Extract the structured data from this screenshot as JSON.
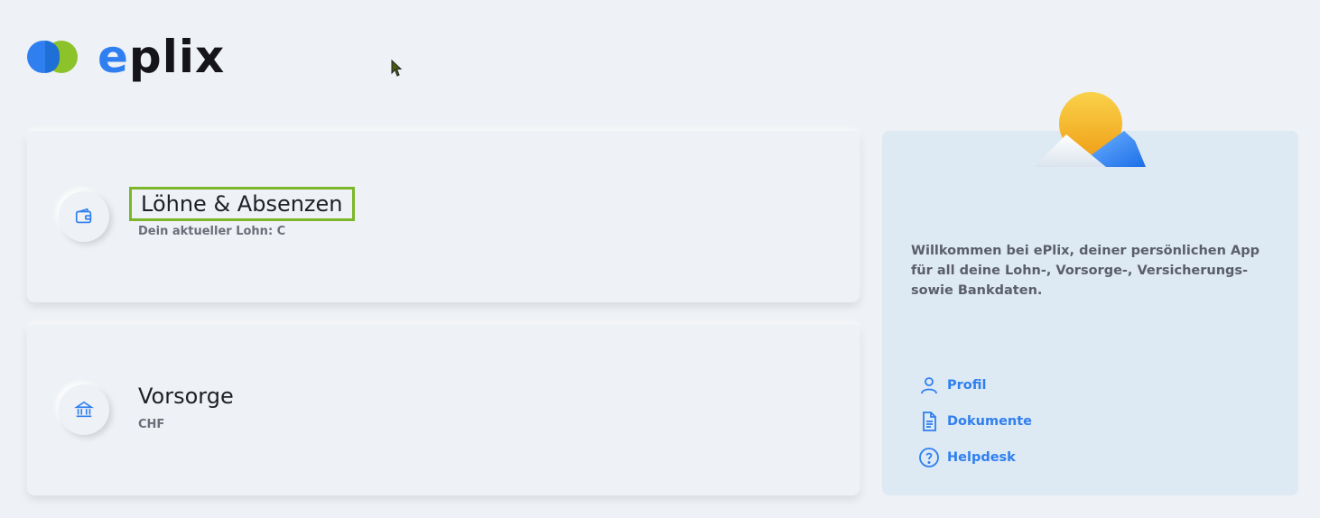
{
  "brand": {
    "name_prefix": "e",
    "name_rest": "plix"
  },
  "cards": [
    {
      "title": "Löhne & Absenzen",
      "subtitle": "Dein aktueller Lohn: C",
      "icon": "wallet-icon"
    },
    {
      "title": "Vorsorge",
      "subtitle": "CHF",
      "icon": "bank-icon"
    }
  ],
  "sidebar": {
    "welcome": "Willkommen bei ePlix, deiner persönlichen App für all deine Lohn-, Vorsorge-, Versicherungs- sowie Bankdaten.",
    "links": [
      {
        "label": "Profil",
        "icon": "user-icon"
      },
      {
        "label": "Dokumente",
        "icon": "document-icon"
      },
      {
        "label": "Helpdesk",
        "icon": "help-icon"
      }
    ]
  },
  "colors": {
    "accent": "#2f7ff0",
    "brand_green": "#8cc22a",
    "highlight": "#7cb62a"
  }
}
